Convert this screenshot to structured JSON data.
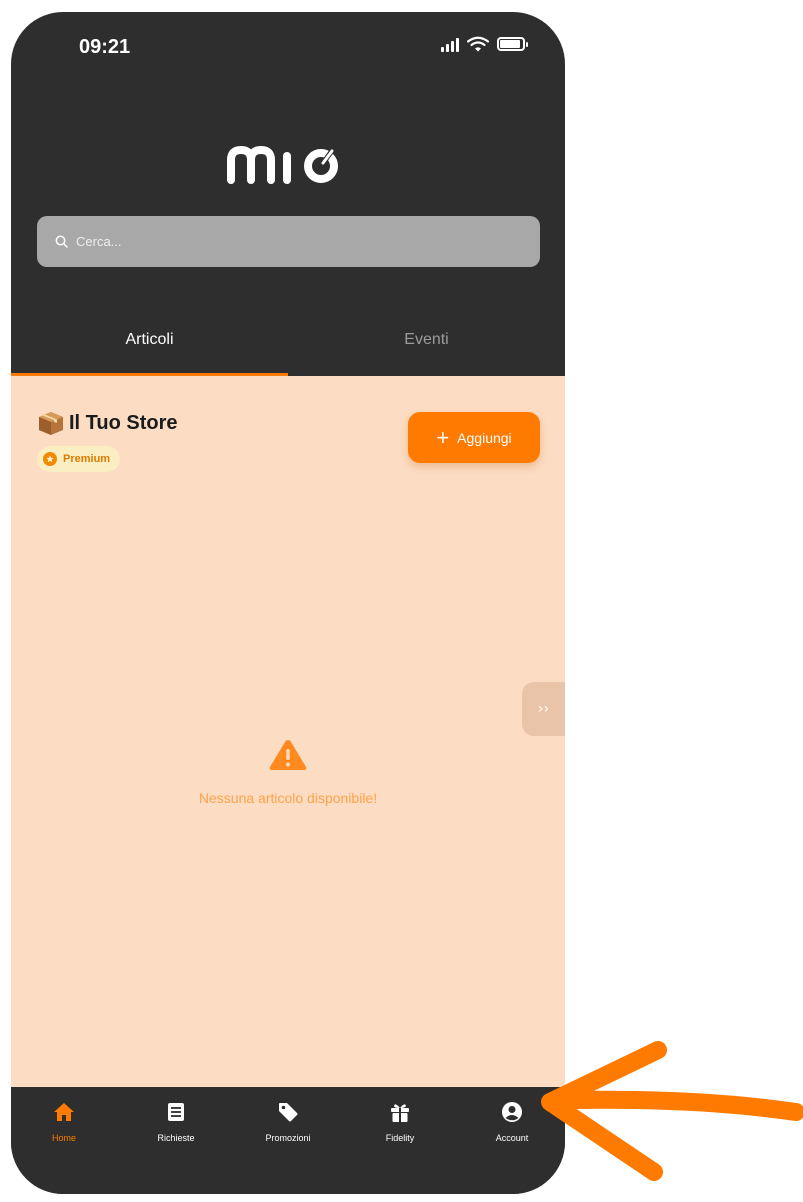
{
  "status_bar": {
    "time": "09:21"
  },
  "header": {
    "logo_text": "mio"
  },
  "search": {
    "placeholder": "Cerca..."
  },
  "tabs": [
    {
      "label": "Articoli",
      "active": true
    },
    {
      "label": "Eventi",
      "active": false
    }
  ],
  "store": {
    "title": "Il Tuo Store",
    "badge": "Premium",
    "add_button": "Aggiungi"
  },
  "empty_state": {
    "message": "Nessuna articolo disponibile!"
  },
  "bottom_nav": [
    {
      "label": "Home",
      "icon": "home-icon",
      "active": true
    },
    {
      "label": "Richieste",
      "icon": "list-icon",
      "active": false
    },
    {
      "label": "Promozioni",
      "icon": "tag-icon",
      "active": false
    },
    {
      "label": "Fidelity",
      "icon": "gift-icon",
      "active": false
    },
    {
      "label": "Account",
      "icon": "account-icon",
      "active": false
    }
  ],
  "colors": {
    "accent": "#ff7a00",
    "dark": "#2e2e2e",
    "content_bg": "#fcdcc2"
  }
}
